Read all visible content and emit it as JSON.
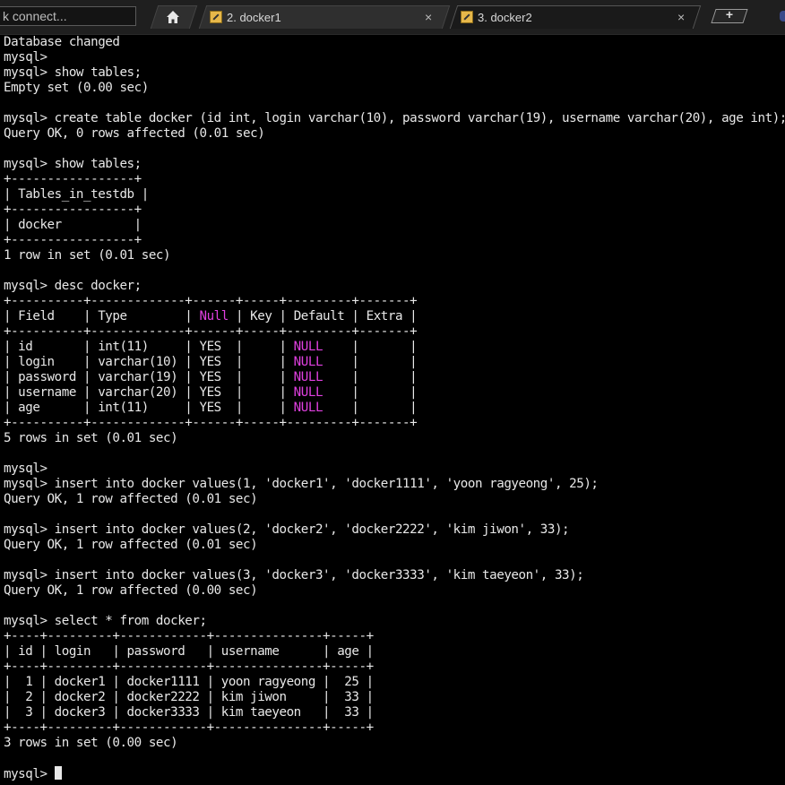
{
  "window": {
    "quick_connect": "k connect...",
    "tabs": [
      {
        "label": "2. docker1",
        "icon": "terminal-icon",
        "close": "×"
      },
      {
        "label": "3. docker2",
        "icon": "terminal-icon",
        "close": "×"
      }
    ],
    "home_icon": "home-icon",
    "new_tab_label": "+"
  },
  "terminal": {
    "accent_color": "#e040e0",
    "lines": [
      "Database changed",
      "mysql>",
      "mysql> show tables;",
      "Empty set (0.00 sec)",
      "",
      "mysql> create table docker (id int, login varchar(10), password varchar(19), username varchar(20), age int);",
      "Query OK, 0 rows affected (0.01 sec)",
      "",
      "mysql> show tables;",
      "+-----------------+",
      "| Tables_in_testdb |",
      "+-----------------+",
      "| docker          |",
      "+-----------------+",
      "1 row in set (0.01 sec)",
      "",
      "mysql> desc docker;",
      "+----------+-------------+------+-----+---------+-------+",
      "| Field    | Type        | Null | Key | Default | Extra |",
      "+----------+-------------+------+-----+---------+-------+",
      "| id       | int(11)     | YES  |     | NULL    |       |",
      "| login    | varchar(10) | YES  |     | NULL    |       |",
      "| password | varchar(19) | YES  |     | NULL    |       |",
      "| username | varchar(20) | YES  |     | NULL    |       |",
      "| age      | int(11)     | YES  |     | NULL    |       |",
      "+----------+-------------+------+-----+---------+-------+",
      "5 rows in set (0.01 sec)",
      "",
      "mysql>",
      "mysql> insert into docker values(1, 'docker1', 'docker1111', 'yoon ragyeong', 25);",
      "Query OK, 1 row affected (0.01 sec)",
      "",
      "mysql> insert into docker values(2, 'docker2', 'docker2222', 'kim jiwon', 33);",
      "Query OK, 1 row affected (0.01 sec)",
      "",
      "mysql> insert into docker values(3, 'docker3', 'docker3333', 'kim taeyeon', 33);",
      "Query OK, 1 row affected (0.00 sec)",
      "",
      "mysql> select * from docker;",
      "+----+---------+------------+---------------+-----+",
      "| id | login   | password   | username      | age |",
      "+----+---------+------------+---------------+-----+",
      "|  1 | docker1 | docker1111 | yoon ragyeong |  25 |",
      "|  2 | docker2 | docker2222 | kim jiwon     |  33 |",
      "|  3 | docker3 | docker3333 | kim taeyeon   |  33 |",
      "+----+---------+------------+---------------+-----+",
      "3 rows in set (0.00 sec)",
      "",
      "mysql> "
    ]
  }
}
